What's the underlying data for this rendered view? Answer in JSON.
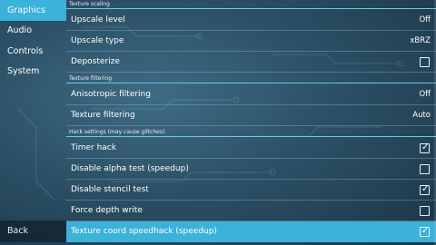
{
  "sidebar": {
    "items": [
      {
        "label": "Graphics",
        "active": true
      },
      {
        "label": "Audio",
        "active": false
      },
      {
        "label": "Controls",
        "active": false
      },
      {
        "label": "System",
        "active": false
      }
    ],
    "back_label": "Back"
  },
  "sections": {
    "texture_scaling": {
      "header": "Texture scaling",
      "upscale_level": {
        "label": "Upscale level",
        "value": "Off"
      },
      "upscale_type": {
        "label": "Upscale type",
        "value": "xBRZ"
      },
      "deposterize": {
        "label": "Deposterize",
        "checked": false
      }
    },
    "texture_filtering": {
      "header": "Texture filtering",
      "anisotropic": {
        "label": "Anisotropic filtering",
        "value": "Off"
      },
      "filtering": {
        "label": "Texture filtering",
        "value": "Auto"
      }
    },
    "hack_settings": {
      "header": "Hack settings (may cause glitches)",
      "timer_hack": {
        "label": "Timer hack",
        "checked": true
      },
      "disable_alpha": {
        "label": "Disable alpha test (speedup)",
        "checked": false
      },
      "disable_stencil": {
        "label": "Disable stencil test",
        "checked": true
      },
      "force_depth": {
        "label": "Force depth write",
        "checked": false
      },
      "texture_coord": {
        "label": "Texture coord speedhack (speedup)",
        "checked": true
      }
    }
  },
  "colors": {
    "accent": "#3bb2da",
    "background": "#2c5066"
  },
  "icons": {
    "checked": "checkmark-icon"
  }
}
